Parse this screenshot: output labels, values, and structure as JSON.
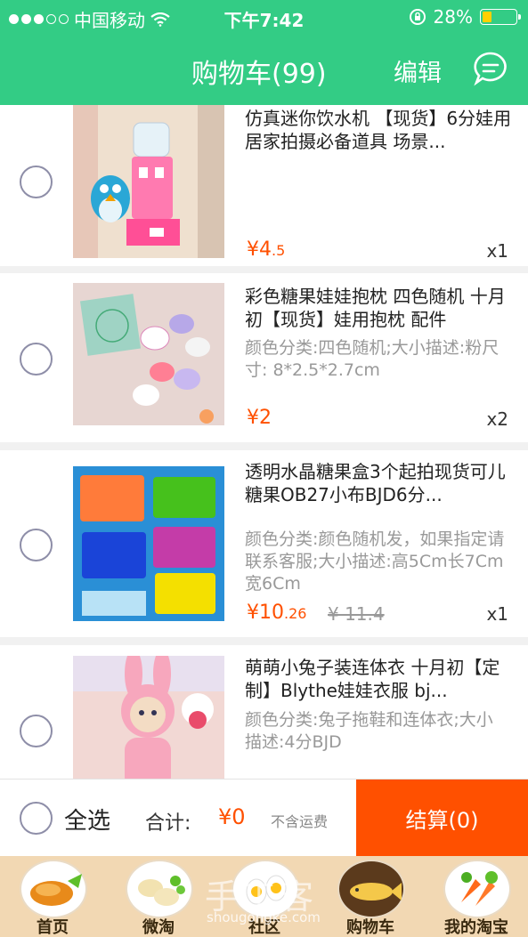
{
  "status": {
    "carrier": "中国移动",
    "time": "下午7:42",
    "battery": "28%"
  },
  "header": {
    "title": "购物车(99)",
    "edit": "编辑"
  },
  "items": [
    {
      "title": "仿真迷你饮水机 【现货】6分娃用居家拍摄必备道具 场景...",
      "sku": "",
      "price_symbol": "¥",
      "price_int": "4",
      "price_dec": ".5",
      "old_price": "",
      "qty": "x1"
    },
    {
      "title": "彩色糖果娃娃抱枕 四色随机 十月初【现货】娃用抱枕 配件",
      "sku": "颜色分类:四色随机;大小描述:粉尺寸: 8*2.5*2.7cm",
      "price_symbol": "¥",
      "price_int": "2",
      "price_dec": "",
      "old_price": "",
      "qty": "x2"
    },
    {
      "title": "透明水晶糖果盒3个起拍现货可儿糖果OB27小布BJD6分...",
      "sku": "颜色分类:颜色随机发，如果指定请联系客服;大小描述:高5Cm长7Cm宽6Cm",
      "price_symbol": "¥",
      "price_int": "10",
      "price_dec": ".26",
      "old_price": "¥ 11.4",
      "qty": "x1"
    },
    {
      "title": "萌萌小兔子装连体衣 十月初【定制】Blythe娃娃衣服 bj...",
      "sku": "颜色分类:兔子拖鞋和连体衣;大小描述:4分BJD",
      "price_symbol": "",
      "price_int": "",
      "price_dec": "",
      "old_price": "",
      "qty": ""
    }
  ],
  "summary": {
    "select_all": "全选",
    "total_label": "合计:",
    "total_value": "¥0",
    "shipping_note": "不含运费",
    "checkout": "结算(0)"
  },
  "tabs": [
    {
      "label": "首页",
      "icon": "roast-chicken-icon"
    },
    {
      "label": "微淘",
      "icon": "dumplings-icon"
    },
    {
      "label": "社区",
      "icon": "eggs-icon"
    },
    {
      "label": "购物车",
      "icon": "fish-icon"
    },
    {
      "label": "我的淘宝",
      "icon": "vegetables-icon"
    }
  ],
  "watermark": {
    "text": "手工客",
    "url": "shougongke.com"
  },
  "colors": {
    "brand_green": "#33cc85",
    "accent_orange": "#ff5000"
  }
}
